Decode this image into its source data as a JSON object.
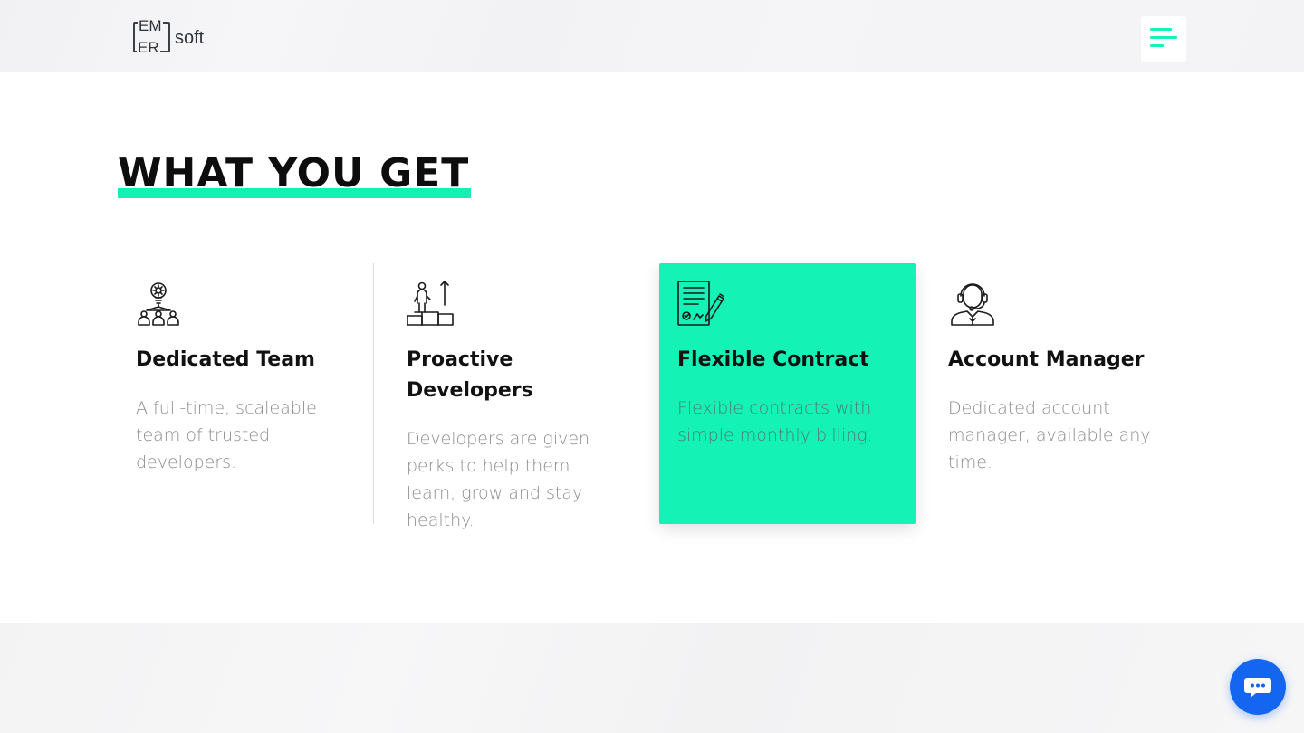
{
  "header": {
    "logo": {
      "line1": "EM",
      "line2": "ER",
      "suffix": "soft"
    },
    "menu_icon": "hamburger-menu-icon"
  },
  "section": {
    "title": "WHAT YOU GET"
  },
  "features": [
    {
      "icon": "team-lightbulb-icon",
      "title": "Dedicated Team",
      "description": "A full-time, scaleable team of trusted developers."
    },
    {
      "icon": "developer-growth-icon",
      "title": "Proactive Developers",
      "description": "Developers are given perks to help them learn, grow and stay healthy."
    },
    {
      "icon": "contract-signing-icon",
      "title": "Flexible Contract",
      "description": "Flexible contracts with simple monthly billing."
    },
    {
      "icon": "account-manager-headset-icon",
      "title": "Account Manager",
      "description": "Dedicated account manager, available any time."
    }
  ],
  "chat": {
    "icon": "chat-bubble-icon"
  },
  "colors": {
    "accent": "#14f2b5",
    "chat_button": "#1465f0",
    "heading": "#111111",
    "body_text": "#8c8c8c"
  }
}
